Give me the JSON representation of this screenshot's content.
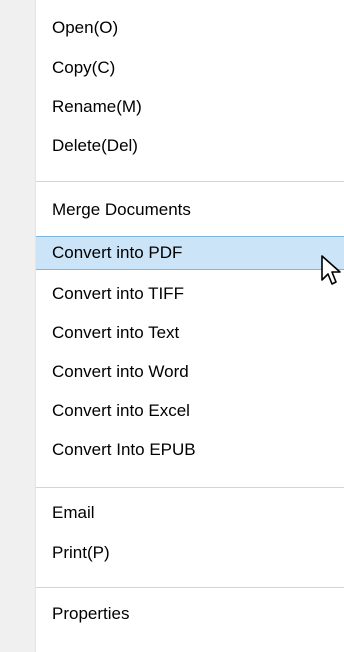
{
  "menu": {
    "items": [
      {
        "label": "Open(O)"
      },
      {
        "label": "Copy(C)"
      },
      {
        "label": "Rename(M)"
      },
      {
        "label": "Delete(Del)"
      },
      {
        "label": "Merge Documents"
      },
      {
        "label": "Convert into PDF",
        "highlighted": true
      },
      {
        "label": "Convert into TIFF"
      },
      {
        "label": "Convert into Text"
      },
      {
        "label": "Convert into Word"
      },
      {
        "label": "Convert into Excel"
      },
      {
        "label": "Convert Into EPUB"
      },
      {
        "label": "Email"
      },
      {
        "label": "Print(P)"
      },
      {
        "label": "Properties"
      }
    ]
  },
  "colors": {
    "highlight_bg": "#cce4f7",
    "highlight_border": "#7fb6e0",
    "gutter_bg": "#f0f0f0",
    "separator": "#d4d4d4"
  },
  "cursor_icon": "arrow-cursor-icon"
}
